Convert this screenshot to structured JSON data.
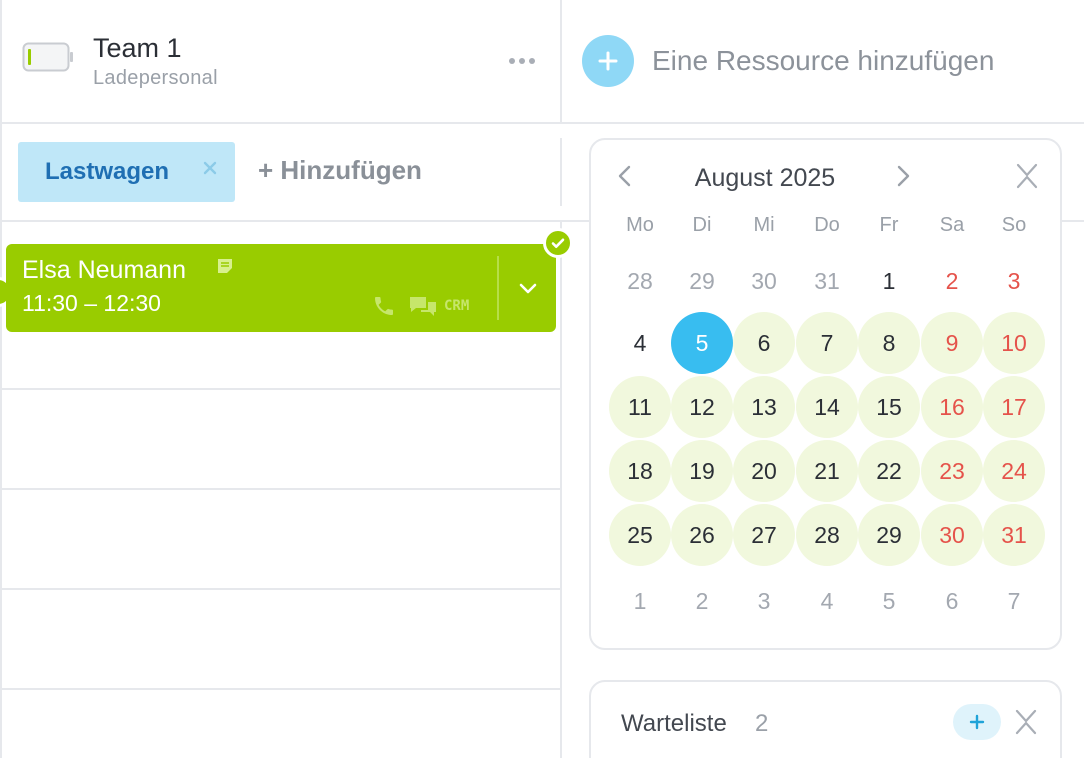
{
  "resource": {
    "name": "Team 1",
    "subtitle": "Ladepersonal",
    "more_icon": "more-horizontal-icon"
  },
  "add_resource": {
    "label": "Eine Ressource hinzufügen",
    "icon": "plus-icon"
  },
  "tags": {
    "items": [
      {
        "label": "Lastwagen"
      }
    ],
    "add_label": "+ Hinzufügen"
  },
  "booking": {
    "name": "Elsa Neumann",
    "time": "11:30 – 12:30",
    "crm_label": "CRM",
    "color": "#99cc00",
    "icons": [
      "note-icon",
      "phone-icon",
      "chat-icon",
      "check-icon",
      "chevron-down-icon"
    ]
  },
  "calendar": {
    "title": "August 2025",
    "weekdays": [
      "Mo",
      "Di",
      "Mi",
      "Do",
      "Fr",
      "Sa",
      "So"
    ],
    "selected_day": "5",
    "weeks": [
      [
        {
          "d": "28",
          "t": "out"
        },
        {
          "d": "29",
          "t": "out"
        },
        {
          "d": "30",
          "t": "out"
        },
        {
          "d": "31",
          "t": "out"
        },
        {
          "d": "1",
          "t": "norm"
        },
        {
          "d": "2",
          "t": "we"
        },
        {
          "d": "3",
          "t": "we"
        }
      ],
      [
        {
          "d": "4",
          "t": "norm"
        },
        {
          "d": "5",
          "t": "sel"
        },
        {
          "d": "6",
          "t": "avail"
        },
        {
          "d": "7",
          "t": "avail"
        },
        {
          "d": "8",
          "t": "avail"
        },
        {
          "d": "9",
          "t": "avail-we"
        },
        {
          "d": "10",
          "t": "avail-we"
        }
      ],
      [
        {
          "d": "11",
          "t": "avail"
        },
        {
          "d": "12",
          "t": "avail"
        },
        {
          "d": "13",
          "t": "avail"
        },
        {
          "d": "14",
          "t": "avail"
        },
        {
          "d": "15",
          "t": "avail"
        },
        {
          "d": "16",
          "t": "avail-we"
        },
        {
          "d": "17",
          "t": "avail-we"
        }
      ],
      [
        {
          "d": "18",
          "t": "avail"
        },
        {
          "d": "19",
          "t": "avail"
        },
        {
          "d": "20",
          "t": "avail"
        },
        {
          "d": "21",
          "t": "avail"
        },
        {
          "d": "22",
          "t": "avail"
        },
        {
          "d": "23",
          "t": "avail-we"
        },
        {
          "d": "24",
          "t": "avail-we"
        }
      ],
      [
        {
          "d": "25",
          "t": "avail"
        },
        {
          "d": "26",
          "t": "avail"
        },
        {
          "d": "27",
          "t": "avail"
        },
        {
          "d": "28",
          "t": "avail"
        },
        {
          "d": "29",
          "t": "avail"
        },
        {
          "d": "30",
          "t": "avail-we"
        },
        {
          "d": "31",
          "t": "avail-we"
        }
      ],
      [
        {
          "d": "1",
          "t": "out"
        },
        {
          "d": "2",
          "t": "out"
        },
        {
          "d": "3",
          "t": "out"
        },
        {
          "d": "4",
          "t": "out"
        },
        {
          "d": "5",
          "t": "out"
        },
        {
          "d": "6",
          "t": "out"
        },
        {
          "d": "7",
          "t": "out"
        }
      ]
    ],
    "colors": {
      "selected": "#38bdf0",
      "available": "#f1f8dd",
      "weekend_text": "#e5534b"
    }
  },
  "waitlist": {
    "title": "Warteliste",
    "count": "2"
  }
}
